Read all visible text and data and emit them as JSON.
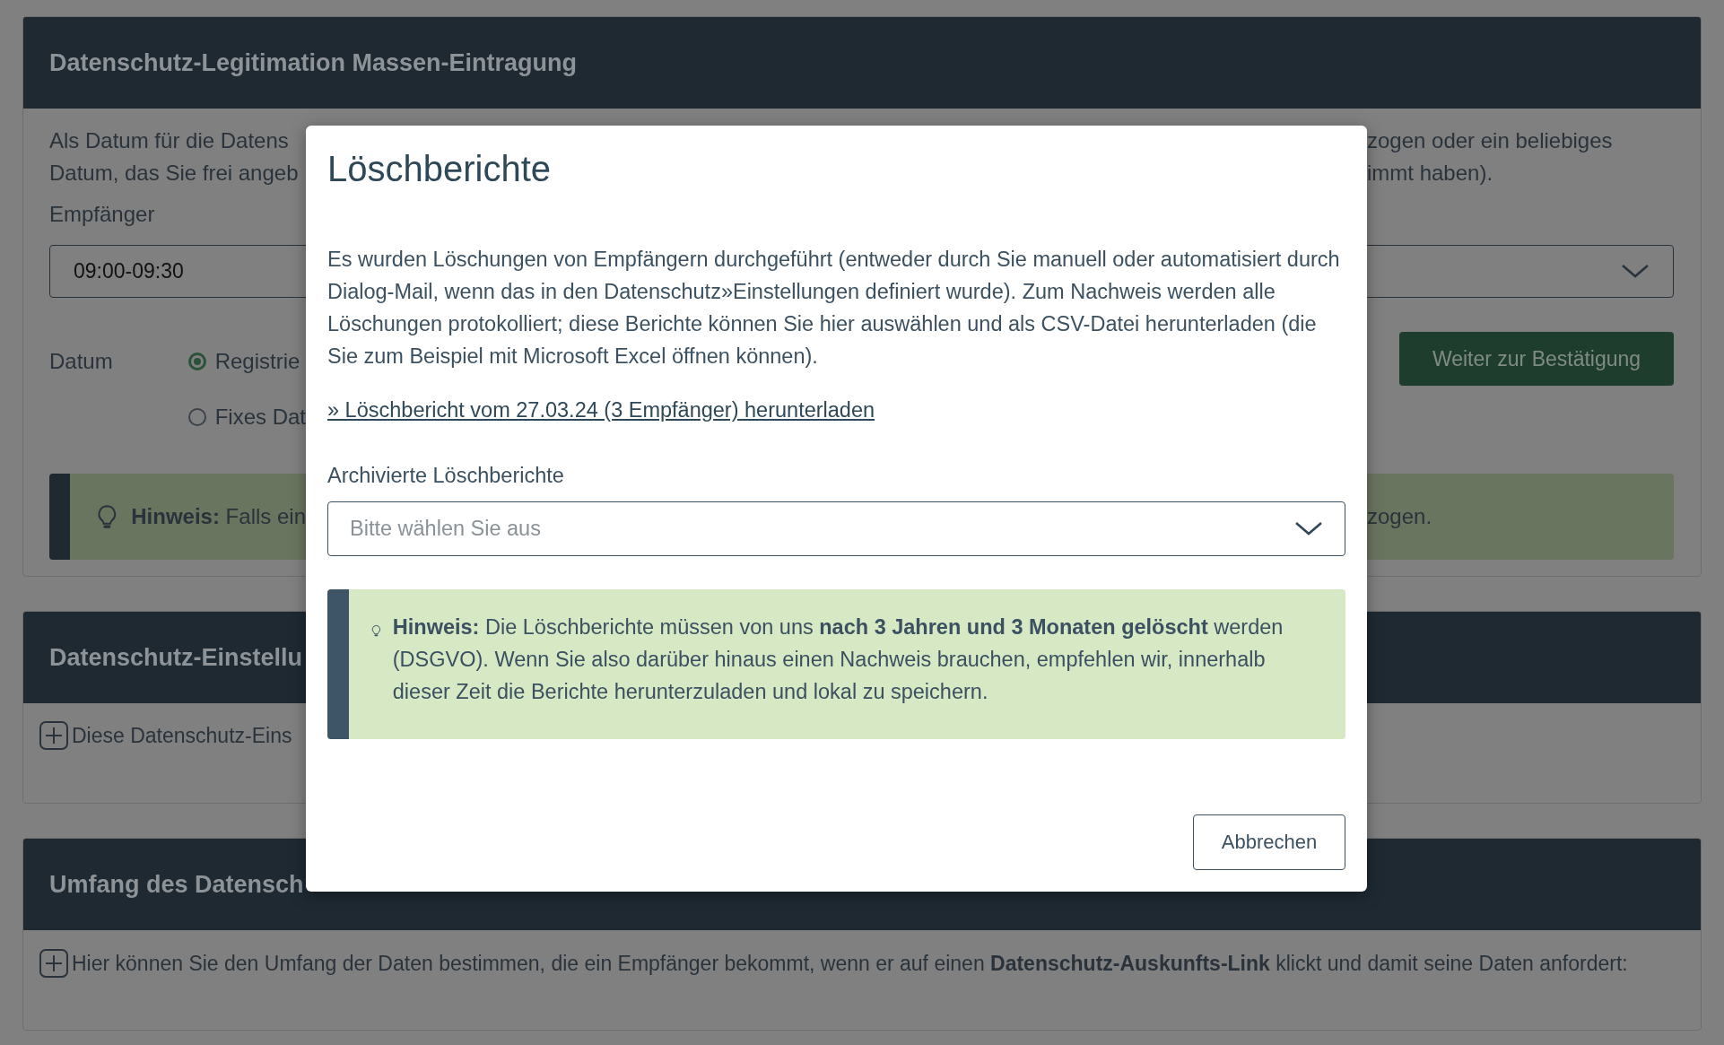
{
  "panels": [
    {
      "kind": "legitimation",
      "title": "Datenschutz-Legitimation Massen-Eintragung",
      "intro_lines": [
        {
          "left": "Als Datum für die Datens",
          "right": "zogen oder ein beliebiges"
        },
        {
          "left": "Datum, das Sie frei angeb",
          "right": "immt haben)."
        }
      ],
      "recipient_label": "Empfänger",
      "recipient_value": "09:00-09:30",
      "date_label": "Datum",
      "date_options": [
        {
          "label": "Registrie",
          "selected": true
        },
        {
          "label": "Fixes Dat",
          "selected": false
        }
      ],
      "confirm_button": "Weiter zur Bestätigung",
      "hint": {
        "left": "**Hinweis:** Falls ein",
        "right": "zogen."
      }
    },
    {
      "kind": "expander",
      "title": "Datenschutz-Einstellu",
      "text": "Diese Datenschutz-Eins"
    },
    {
      "kind": "expander",
      "title": "Umfang des Datensch",
      "text": "Hier können Sie den Umfang der Daten bestimmen, die ein Empfänger bekommt, wenn er auf einen **Datenschutz-Auskunfts-Link** klickt und damit seine Daten anfordert:"
    }
  ],
  "dialog": {
    "title": "Löschberichte",
    "text": "Es wurden Löschungen von Empfängern durchgeführt (entweder durch Sie manuell oder automatisiert durch Dialog-Mail, wenn das in den Datenschutz»Einstellungen definiert wurde). Zum Nachweis werden alle Löschungen protokolliert; diese Berichte können Sie hier auswählen und als CSV-Datei herunterladen (die Sie zum Beispiel mit Microsoft Excel öffnen können).",
    "download_link": "» Löschbericht vom 27.03.24 (3 Empfänger) herunterladen",
    "archive_label": "Archivierte Löschberichte",
    "archive_select": {
      "placeholder": "Bitte wählen Sie aus"
    },
    "hint": "**Hinweis:** Die Löschberichte müssen von uns **nach 3 Jahren und 3 Monaten gelöscht** werden (DSGVO). Wenn Sie also darüber hinaus einen Nachweis brauchen, empfehlen wir, innerhalb dieser Zeit die Berichte herunterzuladen und lokal zu speichern.",
    "cancel_button": "Abbrechen"
  }
}
